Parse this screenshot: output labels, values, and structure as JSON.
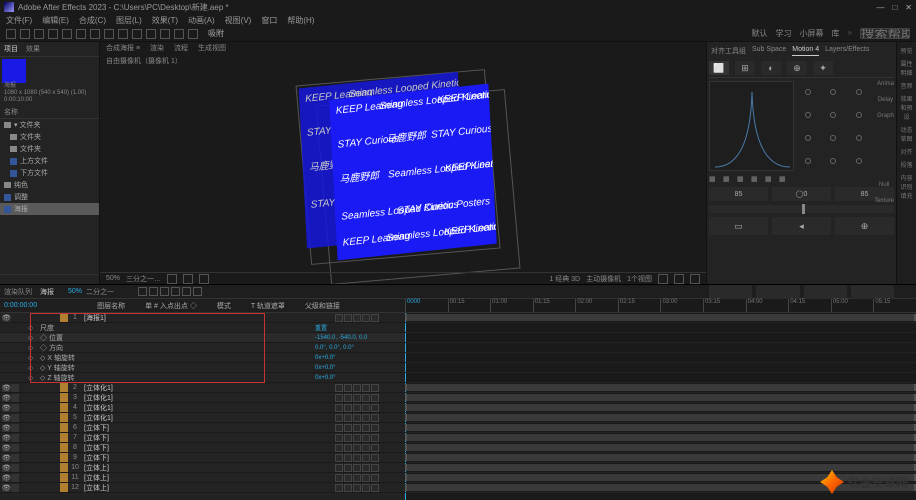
{
  "window": {
    "title": "Adobe After Effects 2023 - C:\\Users\\PC\\Desktop\\新建.aep *"
  },
  "win_controls": {
    "min": "—",
    "max": "□",
    "close": "✕"
  },
  "menu": [
    "文件(F)",
    "编辑(E)",
    "合成(C)",
    "图层(L)",
    "效果(T)",
    "动画(A)",
    "视图(V)",
    "窗口",
    "帮助(H)"
  ],
  "toolbar": {
    "right": [
      "默认",
      "学习",
      "小屏幕",
      "库"
    ],
    "search_ph": "搜索帮助"
  },
  "project": {
    "tabs": [
      "项目",
      "效果"
    ],
    "info_name": "海报",
    "info_dims": "1080 x 1080 (540 x 540) (1.00)",
    "info_dur": "0:00:10:00",
    "rows": [
      {
        "name": "名称",
        "t": "h"
      },
      {
        "name": "▾ 文件夹",
        "t": "f"
      },
      {
        "name": "文件夹",
        "t": "f"
      },
      {
        "name": "文件夹",
        "t": "f"
      },
      {
        "name": "上方文件",
        "t": "c"
      },
      {
        "name": "下方文件",
        "t": "c"
      },
      {
        "name": "纯色",
        "t": "f"
      },
      {
        "name": "调整",
        "t": "c"
      },
      {
        "name": "海报",
        "t": "c",
        "sel": true
      }
    ]
  },
  "viewport": {
    "header_tabs": "合成海报 ≡",
    "header_opts": [
      "渲染",
      "流程",
      "生成视图"
    ],
    "camera": "自由摄像机（摄像机 1）",
    "poster_texts": [
      "KEEP Learning",
      "Seamless Looped Kinetic Posters",
      "STAY Curious",
      "马鹿野郎"
    ],
    "footer": {
      "zoom": "50%",
      "res": "三分之一…",
      "camera_d": "1 经典 3D",
      "camera_r": "主动摄像机",
      "views": "1个视图"
    }
  },
  "right": {
    "tabs": [
      "对齐工具组",
      "Sub Space",
      "Motion 4",
      "Layers/Effects"
    ],
    "active_tab": 2,
    "side_labels": [
      "Anima",
      "Delay",
      "Graph",
      "Null",
      "Texture"
    ],
    "strip": [
      "预览",
      "属性明细",
      "音频",
      "效果和预设",
      "动态草图",
      "对齐",
      "段落",
      "内容识别填充"
    ],
    "num_l": "85",
    "num_r": "85",
    "num_c": "0"
  },
  "timeline": {
    "timecode": "0:00:00:00",
    "tabs": [
      "渲染队列",
      "海报"
    ],
    "btns_label": "二分之一",
    "columns": [
      "图层名称",
      "单 # 入点出点 ◇",
      "模式",
      "T 轨道遮罩",
      "父级和链接"
    ],
    "ruler": [
      "0000",
      "00:15",
      "01:00",
      "01:15",
      "02:00",
      "02:15",
      "03:00",
      "03:15",
      "04:00",
      "04:15",
      "05:00",
      "05:15"
    ],
    "sel_layer": {
      "num": "1",
      "name": "[海报1]",
      "props": [
        {
          "name": "尺度",
          "val": "重置"
        },
        {
          "name": "◇ 位置",
          "val": "-1540.0, -540.0, 0.0"
        },
        {
          "name": "◇ 方向",
          "val": "0.0°, 0.0°, 0.0°"
        },
        {
          "name": "◇ X 轴旋转",
          "val": "0x+0.0°"
        },
        {
          "name": "◇ Y 轴旋转",
          "val": "0x+0.0°"
        },
        {
          "name": "◇ Z 轴旋转",
          "val": "0x+0.0°"
        }
      ]
    },
    "layers": [
      {
        "n": "2",
        "name": "[立体化1]"
      },
      {
        "n": "3",
        "name": "[立体化1]"
      },
      {
        "n": "4",
        "name": "[立体化1]"
      },
      {
        "n": "5",
        "name": "[立体化1]"
      },
      {
        "n": "6",
        "name": "[立体下]"
      },
      {
        "n": "7",
        "name": "[立体下]"
      },
      {
        "n": "8",
        "name": "[立体下]"
      },
      {
        "n": "9",
        "name": "[立体下]"
      },
      {
        "n": "10",
        "name": "[立体上]"
      },
      {
        "n": "11",
        "name": "[立体上]"
      },
      {
        "n": "12",
        "name": "[立体上]"
      }
    ]
  },
  "watermark": "亿金安卓网"
}
